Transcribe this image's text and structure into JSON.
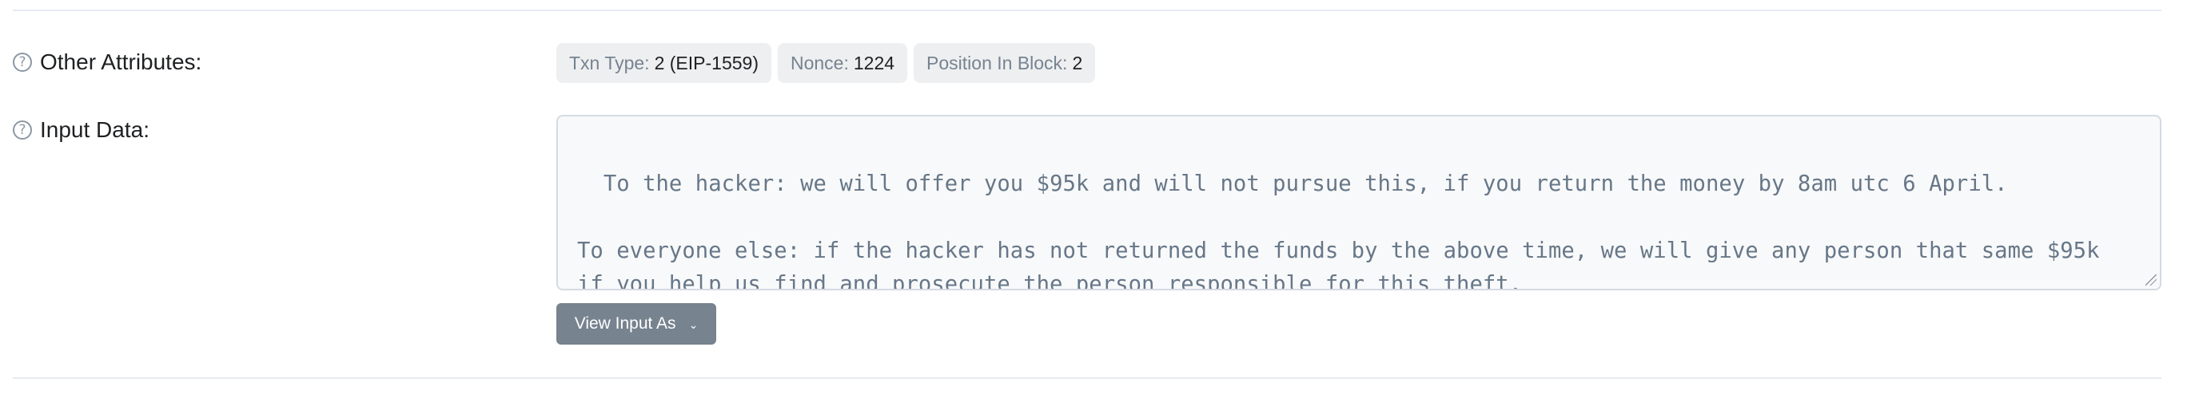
{
  "other_attributes": {
    "label": "Other Attributes:",
    "badges": [
      {
        "key": "Txn Type:",
        "value": "2 (EIP-1559)"
      },
      {
        "key": "Nonce:",
        "value": "1224"
      },
      {
        "key": "Position In Block:",
        "value": "2"
      }
    ]
  },
  "input_data": {
    "label": "Input Data:",
    "text": "To the hacker: we will offer you $95k and will not pursue this, if you return the money by 8am utc 6 April.\n\nTo everyone else: if the hacker has not returned the funds by the above time, we will give any person that same $95k\nif you help us find and prosecute the person responsible for this theft.",
    "view_button_label": "View Input As",
    "help_icon_glyph": "?",
    "chevron_glyph": "⌄"
  },
  "colors": {
    "badge_bg": "#edeff1",
    "muted_text": "#77838f",
    "button_bg": "#77838f",
    "textarea_bg": "#f8f9fa",
    "divider": "#e7eaf3"
  }
}
